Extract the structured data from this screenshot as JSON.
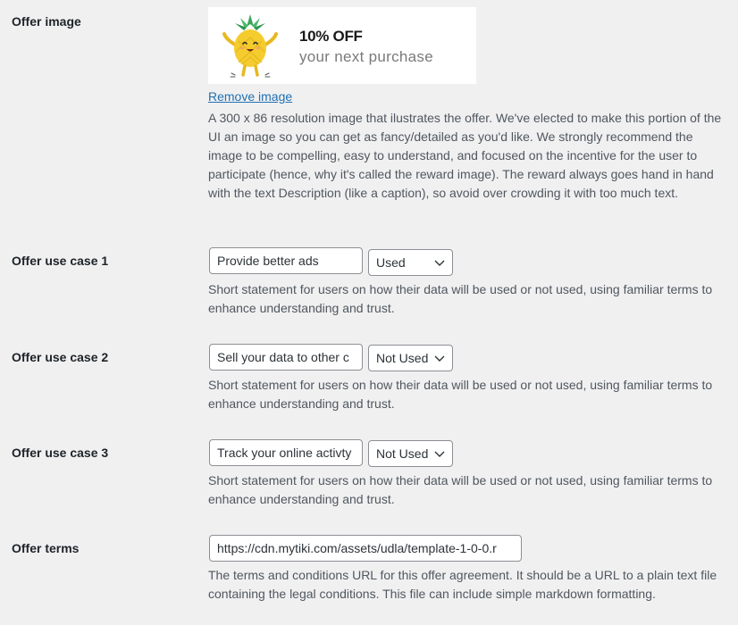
{
  "offer_image": {
    "label": "Offer image",
    "banner_headline": "10% OFF",
    "banner_subline": "your next purchase",
    "remove_link": "Remove image",
    "description": "A 300 x 86 resolution image that ilustrates the offer. We've elected to make this portion of the UI an image so you can get as fancy/detailed as you'd like. We strongly recommend the image to be compelling, easy to understand, and focused on the incentive for the user to participate (hence, why it's called the reward image). The reward always goes hand in hand with the text Description (like a caption), so avoid over crowding it with too much text."
  },
  "use_cases": [
    {
      "label": "Offer use case 1",
      "input_value": "Provide better ads",
      "select_value": "Used",
      "description": "Short statement for users on how their data will be used or not used, using familiar terms to enhance understanding and trust."
    },
    {
      "label": "Offer use case 2",
      "input_value": "Sell your data to other c",
      "select_value": "Not Used",
      "description": "Short statement for users on how their data will be used or not used, using familiar terms to enhance understanding and trust."
    },
    {
      "label": "Offer use case 3",
      "input_value": "Track your online activty",
      "select_value": "Not Used",
      "description": "Short statement for users on how their data will be used or not used, using familiar terms to enhance understanding and trust."
    }
  ],
  "offer_terms": {
    "label": "Offer terms",
    "input_value": "https://cdn.mytiki.com/assets/udla/template-1-0-0.r",
    "description": "The terms and conditions URL for this offer agreement. It should be a URL to a plain text file containing the legal conditions. This file can include simple markdown formatting."
  },
  "icons": {
    "select_chevron": "chevron-down-icon",
    "mascot": "pineapple-icon"
  },
  "colors": {
    "background": "#f0f0f1",
    "link": "#2271b1",
    "description_text": "#50575e",
    "label_text": "#1d2327",
    "input_border": "#8c8f94"
  }
}
